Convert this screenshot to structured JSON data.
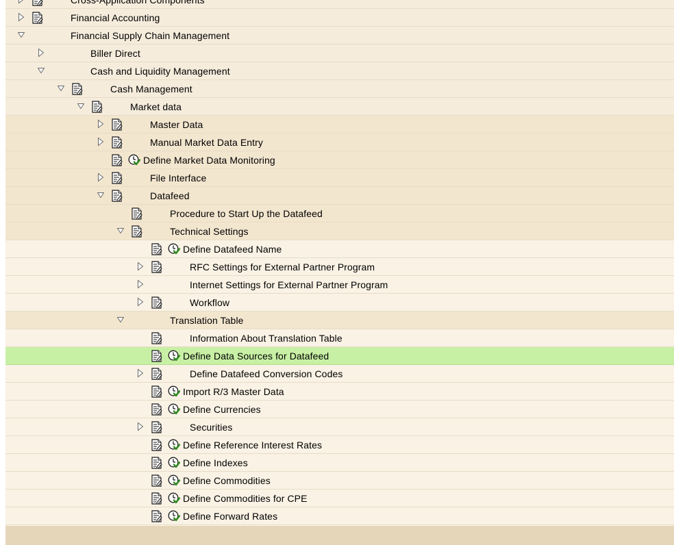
{
  "tree": {
    "items": [
      {
        "label": "Cross-Application Components",
        "level": 0,
        "toggle": "collapsed",
        "doc": true,
        "exec": false
      },
      {
        "label": "Financial Accounting",
        "level": 0,
        "toggle": "collapsed",
        "doc": true,
        "exec": false
      },
      {
        "label": "Financial Supply Chain Management",
        "level": 0,
        "toggle": "expanded",
        "doc": false,
        "exec": false
      },
      {
        "label": "Biller Direct",
        "level": 1,
        "toggle": "collapsed",
        "doc": false,
        "exec": false
      },
      {
        "label": "Cash and Liquidity Management",
        "level": 1,
        "toggle": "expanded",
        "doc": false,
        "exec": false
      },
      {
        "label": "Cash Management",
        "level": 2,
        "toggle": "expanded",
        "doc": true,
        "exec": false
      },
      {
        "label": "Market data",
        "level": 3,
        "toggle": "expanded",
        "doc": true,
        "exec": false
      },
      {
        "label": "Master Data",
        "level": 4,
        "toggle": "collapsed",
        "doc": true,
        "exec": false
      },
      {
        "label": "Manual Market Data Entry",
        "level": 4,
        "toggle": "collapsed",
        "doc": true,
        "exec": false
      },
      {
        "label": "Define Market Data Monitoring",
        "level": 4,
        "toggle": "none",
        "doc": true,
        "exec": true
      },
      {
        "label": "File Interface",
        "level": 4,
        "toggle": "collapsed",
        "doc": true,
        "exec": false
      },
      {
        "label": "Datafeed",
        "level": 4,
        "toggle": "expanded",
        "doc": true,
        "exec": false
      },
      {
        "label": "Procedure to Start Up the Datafeed",
        "level": 5,
        "toggle": "none",
        "doc": true,
        "exec": false
      },
      {
        "label": "Technical Settings",
        "level": 5,
        "toggle": "expanded",
        "doc": true,
        "exec": false
      },
      {
        "label": "Define Datafeed Name",
        "level": 6,
        "toggle": "none",
        "doc": true,
        "exec": true
      },
      {
        "label": "RFC Settings for External Partner Program",
        "level": 6,
        "toggle": "collapsed",
        "doc": true,
        "exec": false
      },
      {
        "label": "Internet Settings for External Partner Program",
        "level": 6,
        "toggle": "collapsed",
        "doc": false,
        "exec": false
      },
      {
        "label": "Workflow",
        "level": 6,
        "toggle": "collapsed",
        "doc": true,
        "exec": false
      },
      {
        "label": "Translation Table",
        "level": 5,
        "toggle": "expanded",
        "doc": false,
        "exec": false
      },
      {
        "label": "Information About Translation Table",
        "level": 6,
        "toggle": "none",
        "doc": true,
        "exec": false
      },
      {
        "label": "Define Data Sources for Datafeed",
        "level": 6,
        "toggle": "none",
        "doc": true,
        "exec": true,
        "selected": true
      },
      {
        "label": "Define Datafeed Conversion Codes",
        "level": 6,
        "toggle": "collapsed",
        "doc": true,
        "exec": false
      },
      {
        "label": "Import R/3 Master Data",
        "level": 6,
        "toggle": "none",
        "doc": true,
        "exec": true
      },
      {
        "label": "Define Currencies",
        "level": 6,
        "toggle": "none",
        "doc": true,
        "exec": true
      },
      {
        "label": "Securities",
        "level": 6,
        "toggle": "collapsed",
        "doc": true,
        "exec": false
      },
      {
        "label": "Define Reference Interest Rates",
        "level": 6,
        "toggle": "none",
        "doc": true,
        "exec": true
      },
      {
        "label": "Define Indexes",
        "level": 6,
        "toggle": "none",
        "doc": true,
        "exec": true
      },
      {
        "label": "Define Commodities",
        "level": 6,
        "toggle": "none",
        "doc": true,
        "exec": true
      },
      {
        "label": "Define Commodities for CPE",
        "level": 6,
        "toggle": "none",
        "doc": true,
        "exec": true
      },
      {
        "label": "Define Forward Rates",
        "level": 6,
        "toggle": "none",
        "doc": true,
        "exec": true
      }
    ]
  },
  "icons": {
    "doc": "document-icon",
    "exec": "execute-clock-icon",
    "collapsed": "triangle-right-icon",
    "expanded": "triangle-down-icon"
  },
  "colors": {
    "selected_row": "#c8f0a5",
    "row_background": "#fbf5ea",
    "footer": "#e6d6b9"
  }
}
